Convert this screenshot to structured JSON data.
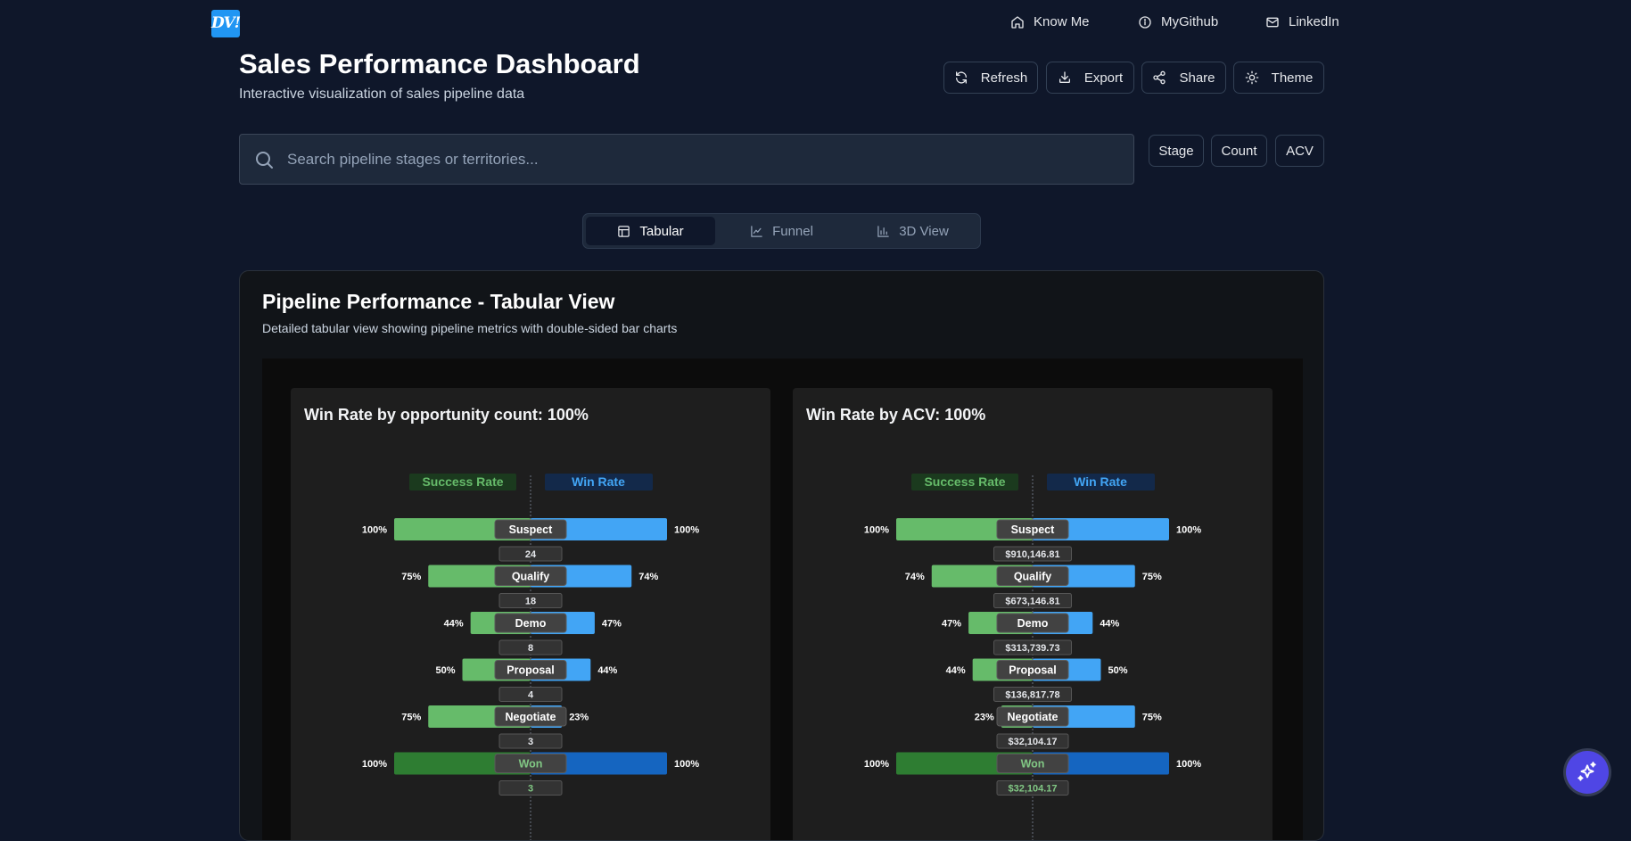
{
  "nav": {
    "logo": "DV!",
    "links": [
      {
        "label": "Know Me",
        "icon": "home-icon"
      },
      {
        "label": "MyGithub",
        "icon": "info-icon"
      },
      {
        "label": "LinkedIn",
        "icon": "mail-icon"
      }
    ]
  },
  "header": {
    "title": "Sales Performance Dashboard",
    "subtitle": "Interactive visualization of sales pipeline data"
  },
  "actions": {
    "refresh": "Refresh",
    "export": "Export",
    "share": "Share",
    "theme": "Theme"
  },
  "search": {
    "placeholder": "Search pipeline stages or territories..."
  },
  "filters": [
    "Stage",
    "Count",
    "ACV"
  ],
  "tabs": [
    {
      "label": "Tabular",
      "icon": "table-icon",
      "active": true
    },
    {
      "label": "Funnel",
      "icon": "line-chart-icon",
      "active": false
    },
    {
      "label": "3D View",
      "icon": "bar-chart-icon",
      "active": false
    }
  ],
  "panel": {
    "title": "Pipeline Performance - Tabular View",
    "description": "Detailed tabular view showing pipeline metrics with double-sided bar charts"
  },
  "colors": {
    "success": "#66bb6a",
    "success_dark": "#2e7d32",
    "win": "#42a5f5",
    "win_dark": "#1565c0",
    "label_bg": "#424242"
  },
  "chart_data": [
    {
      "type": "bar",
      "title": "Win Rate by opportunity count: 100%",
      "legend_left": "Success Rate",
      "legend_right": "Win Rate",
      "stages": [
        "Suspect",
        "Qualify",
        "Demo",
        "Proposal",
        "Negotiate",
        "Won"
      ],
      "series": [
        {
          "name": "Success Rate",
          "values": [
            100,
            75,
            44,
            50,
            75,
            100
          ],
          "labels": [
            "100%",
            "75%",
            "44%",
            "50%",
            "75%",
            "100%"
          ]
        },
        {
          "name": "Win Rate",
          "values": [
            100,
            74,
            47,
            44,
            23,
            100
          ],
          "labels": [
            "100%",
            "74%",
            "47%",
            "44%",
            "23%",
            "100%"
          ]
        }
      ],
      "stage_values": [
        "24",
        "18",
        "8",
        "4",
        "3",
        "3"
      ],
      "xlim": [
        0,
        100
      ]
    },
    {
      "type": "bar",
      "title": "Win Rate by ACV: 100%",
      "legend_left": "Success Rate",
      "legend_right": "Win Rate",
      "stages": [
        "Suspect",
        "Qualify",
        "Demo",
        "Proposal",
        "Negotiate",
        "Won"
      ],
      "series": [
        {
          "name": "Success Rate",
          "values": [
            100,
            74,
            47,
            44,
            23,
            100
          ],
          "labels": [
            "100%",
            "74%",
            "47%",
            "44%",
            "23%",
            "100%"
          ]
        },
        {
          "name": "Win Rate",
          "values": [
            100,
            75,
            44,
            50,
            75,
            100
          ],
          "labels": [
            "100%",
            "75%",
            "44%",
            "50%",
            "75%",
            "100%"
          ]
        }
      ],
      "stage_values": [
        "$910,146.81",
        "$673,146.81",
        "$313,739.73",
        "$136,817.78",
        "$32,104.17",
        "$32,104.17"
      ],
      "xlim": [
        0,
        100
      ]
    }
  ]
}
